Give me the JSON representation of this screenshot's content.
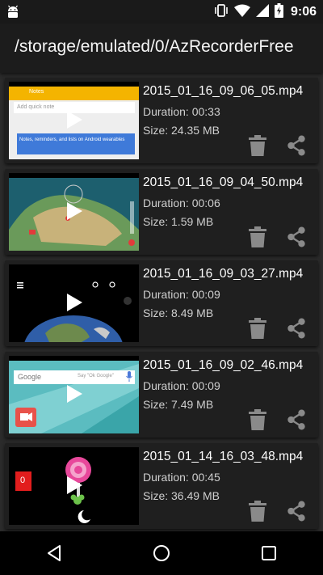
{
  "status_bar": {
    "time": "9:06",
    "icons": [
      "android-debug-icon",
      "vibrate-icon",
      "wifi-icon",
      "signal-icon",
      "battery-charging-icon"
    ]
  },
  "app_bar": {
    "title": "/storage/emulated/0/AzRecorderFree"
  },
  "recordings": [
    {
      "filename": "2015_01_16_09_06_05.mp4",
      "duration": "Duration: 00:33",
      "size": "Size: 24.35 MB",
      "thumb_theme": "notes"
    },
    {
      "filename": "2015_01_16_09_04_50.mp4",
      "duration": "Duration: 00:06",
      "size": "Size: 1.59 MB",
      "thumb_theme": "map"
    },
    {
      "filename": "2015_01_16_09_03_27.mp4",
      "duration": "Duration: 00:09",
      "size": "Size: 8.49 MB",
      "thumb_theme": "earth"
    },
    {
      "filename": "2015_01_16_09_02_46.mp4",
      "duration": "Duration: 00:09",
      "size": "Size: 7.49 MB",
      "thumb_theme": "google"
    },
    {
      "filename": "2015_01_14_16_03_48.mp4",
      "duration": "Duration: 00:45",
      "size": "Size: 36.49 MB",
      "thumb_theme": "lollipop"
    }
  ],
  "thumb_texts": {
    "notes_title": "Notes",
    "notes_hint": "Add quick note",
    "notes_item": "Notes, reminders, and lists on Android wearables",
    "google_logo": "Google",
    "google_hint": "Say \"Ok Google\"",
    "counter": "0"
  },
  "nav_bar": {
    "icons": [
      "back-icon",
      "home-icon",
      "recents-icon"
    ]
  },
  "colors": {
    "background": "#2b2b2b",
    "card": "#1f1f1f",
    "app_bar": "#1c1c1c",
    "icon_gray": "#8a8a8a"
  }
}
